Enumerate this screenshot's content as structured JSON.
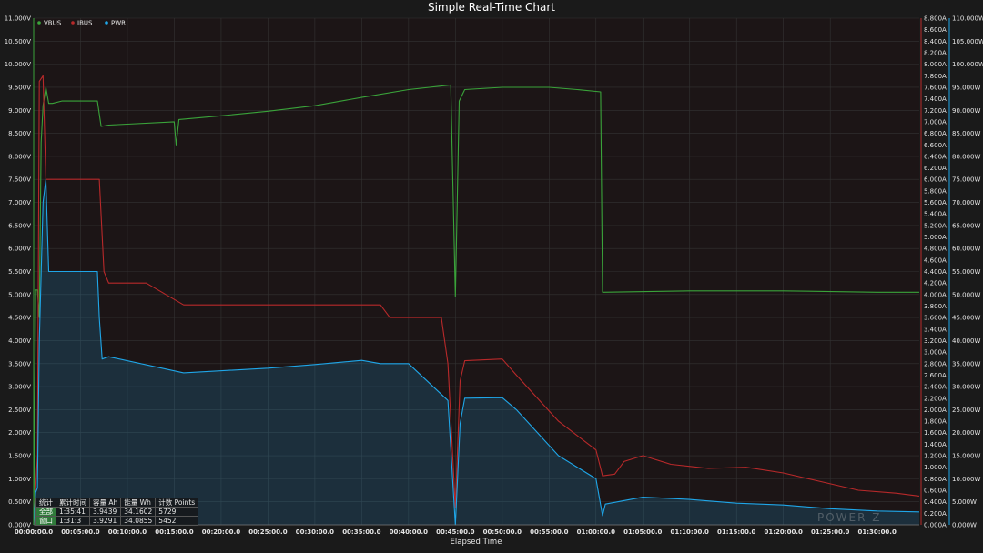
{
  "chart_data": {
    "type": "line",
    "title": "Simple Real-Time Chart",
    "xlabel": "Elapsed Time",
    "x_ticks": [
      "00:00:00.0",
      "00:05:00.0",
      "00:10:00.0",
      "00:15:00.0",
      "00:20:00.0",
      "00:25:00.0",
      "00:30:00.0",
      "00:35:00.0",
      "00:40:00.0",
      "00:45:00.0",
      "00:50:00.0",
      "00:55:00.0",
      "01:00:00.0",
      "01:05:00.0",
      "01:10:00.0",
      "01:15:00.0",
      "01:20:00.0",
      "01:25:00.0",
      "01:30:00.0"
    ],
    "xlim_minutes": [
      0,
      94.5
    ],
    "axes": {
      "left": {
        "unit": "V",
        "min": 0,
        "max": 11,
        "step": 0.5,
        "decimals": 3
      },
      "right1": {
        "unit": "A",
        "min": 0,
        "max": 8.8,
        "step": 0.2,
        "decimals": 3
      },
      "right2": {
        "unit": "W",
        "min": 0,
        "max": 110,
        "step": 5,
        "decimals": 3
      }
    },
    "legend_position": "top-left",
    "grid": true,
    "series": [
      {
        "name": "VBUS",
        "color": "#3aa33a",
        "axis": "left",
        "points": [
          [
            0,
            0
          ],
          [
            0.2,
            5.1
          ],
          [
            0.4,
            5.1
          ],
          [
            0.6,
            4.5
          ],
          [
            0.8,
            8.3
          ],
          [
            1.0,
            9.1
          ],
          [
            1.3,
            9.5
          ],
          [
            1.6,
            9.15
          ],
          [
            2.0,
            9.15
          ],
          [
            3.0,
            9.2
          ],
          [
            6.8,
            9.2
          ],
          [
            7.2,
            8.65
          ],
          [
            8.0,
            8.68
          ],
          [
            15.0,
            8.75
          ],
          [
            15.2,
            8.25
          ],
          [
            15.5,
            8.8
          ],
          [
            20,
            8.88
          ],
          [
            25,
            8.98
          ],
          [
            30,
            9.1
          ],
          [
            35,
            9.28
          ],
          [
            40,
            9.45
          ],
          [
            44.5,
            9.55
          ],
          [
            45.0,
            4.95
          ],
          [
            45.4,
            9.2
          ],
          [
            46,
            9.45
          ],
          [
            50,
            9.5
          ],
          [
            55,
            9.5
          ],
          [
            58,
            9.45
          ],
          [
            60.5,
            9.4
          ],
          [
            60.7,
            5.05
          ],
          [
            70,
            5.08
          ],
          [
            80,
            5.08
          ],
          [
            90,
            5.05
          ],
          [
            94.5,
            5.05
          ]
        ]
      },
      {
        "name": "IBUS",
        "color": "#b8292a",
        "axis": "right1",
        "points": [
          [
            0,
            0
          ],
          [
            0.2,
            0.6
          ],
          [
            0.4,
            1.2
          ],
          [
            0.6,
            7.7
          ],
          [
            1.0,
            7.8
          ],
          [
            1.3,
            6.0
          ],
          [
            2.5,
            6.0
          ],
          [
            7.0,
            6.0
          ],
          [
            7.5,
            4.4
          ],
          [
            8.0,
            4.2
          ],
          [
            12,
            4.2
          ],
          [
            16,
            3.82
          ],
          [
            21,
            3.82
          ],
          [
            27,
            3.82
          ],
          [
            30,
            3.82
          ],
          [
            37,
            3.82
          ],
          [
            38,
            3.6
          ],
          [
            43.5,
            3.6
          ],
          [
            44.2,
            2.8
          ],
          [
            45.0,
            0.3
          ],
          [
            45.5,
            2.5
          ],
          [
            46,
            2.85
          ],
          [
            50,
            2.88
          ],
          [
            51.5,
            2.6
          ],
          [
            56,
            1.8
          ],
          [
            60,
            1.3
          ],
          [
            60.7,
            0.85
          ],
          [
            62,
            0.88
          ],
          [
            63,
            1.1
          ],
          [
            65,
            1.2
          ],
          [
            68,
            1.05
          ],
          [
            72,
            0.98
          ],
          [
            76,
            1.0
          ],
          [
            80,
            0.9
          ],
          [
            84,
            0.75
          ],
          [
            88,
            0.6
          ],
          [
            92,
            0.55
          ],
          [
            94.5,
            0.5
          ]
        ]
      },
      {
        "name": "PWR",
        "color": "#1fa6e8",
        "axis": "right2",
        "fill": true,
        "points": [
          [
            0,
            0
          ],
          [
            0.2,
            7.0
          ],
          [
            0.4,
            8.0
          ],
          [
            0.6,
            40
          ],
          [
            1.0,
            70
          ],
          [
            1.3,
            75
          ],
          [
            1.6,
            55
          ],
          [
            2.5,
            55
          ],
          [
            6.8,
            55
          ],
          [
            7.0,
            45
          ],
          [
            7.3,
            36
          ],
          [
            8.0,
            36.5
          ],
          [
            16,
            33
          ],
          [
            25,
            34
          ],
          [
            30,
            34.8
          ],
          [
            35,
            35.7
          ],
          [
            37,
            35.0
          ],
          [
            40,
            35.0
          ],
          [
            44.2,
            27.0
          ],
          [
            45.0,
            0
          ],
          [
            45.5,
            22
          ],
          [
            46,
            27.5
          ],
          [
            50,
            27.6
          ],
          [
            51.5,
            25
          ],
          [
            56,
            15
          ],
          [
            60,
            10
          ],
          [
            60.7,
            2
          ],
          [
            61,
            4.5
          ],
          [
            65,
            6
          ],
          [
            70,
            5.5
          ],
          [
            75,
            4.7
          ],
          [
            80,
            4.3
          ],
          [
            85,
            3.5
          ],
          [
            90,
            3
          ],
          [
            94.5,
            2.8
          ]
        ]
      }
    ],
    "stats_table": {
      "header": [
        "统计",
        "累计时间",
        "容量 Ah",
        "能量 Wh",
        "计数 Points"
      ],
      "rows": [
        [
          "全部",
          "1:35:41",
          "3.9439",
          "34.1602",
          "5729"
        ],
        [
          "窗口",
          "1:31:3",
          "3.9291",
          "34.0855",
          "5452"
        ]
      ]
    }
  },
  "watermark": "POWER-Z"
}
